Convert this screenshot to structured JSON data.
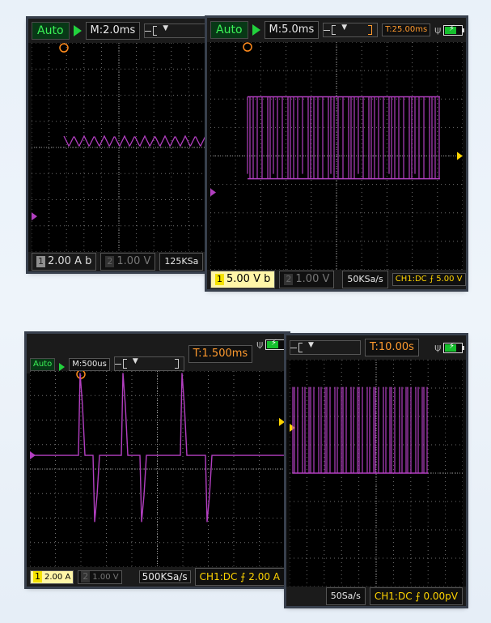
{
  "panel1": {
    "mode": "Auto",
    "timebase": "M:2.0ms",
    "trig_marker": "T",
    "ch1_num": "1",
    "ch1_scale": "2.00 A",
    "ch1_coupling": "b",
    "ch2_num": "2",
    "ch2_scale": "1.00 V",
    "sample_rate": "125KSa"
  },
  "panel2": {
    "mode": "Auto",
    "timebase": "M:5.0ms",
    "trig_marker": "T",
    "trig_time": "T:25.00ms",
    "ch1_num": "1",
    "ch1_scale": "5.00 V",
    "ch1_coupling": "b",
    "ch2_num": "2",
    "ch2_scale": "1.00 V",
    "sample_rate": "50KSa/s",
    "trigger_info": "CH1:DC ⨍ 5.00 V"
  },
  "panel3": {
    "mode": "Auto",
    "timebase": "M:500us",
    "trig_time": "T:1.500ms",
    "trig_marker": "T",
    "ch1_num": "1",
    "ch1_scale": "2.00 A",
    "ch2_num": "2",
    "ch2_scale": "1.00 V",
    "sample_rate": "500KSa/s",
    "trigger_info": "CH1:DC ⨍ 2.00 A"
  },
  "panel4": {
    "trig_time": "T:10.00s",
    "sample_rate": "50Sa/s",
    "trigger_info": "CH1:DC ⨍ 0.00pV"
  },
  "colors": {
    "trace": "#b23fc0",
    "grid": "#6d6d6d",
    "auto_text": "#3bf257",
    "trigger_orange": "#ff9a2e",
    "trigger_yellow": "#ffd400"
  },
  "icons": [
    "run-triangle-icon",
    "usb-icon",
    "battery-charging-icon",
    "trigger-marker-icon",
    "channel-ground-marker-icon",
    "trigger-level-arrow-icon"
  ]
}
